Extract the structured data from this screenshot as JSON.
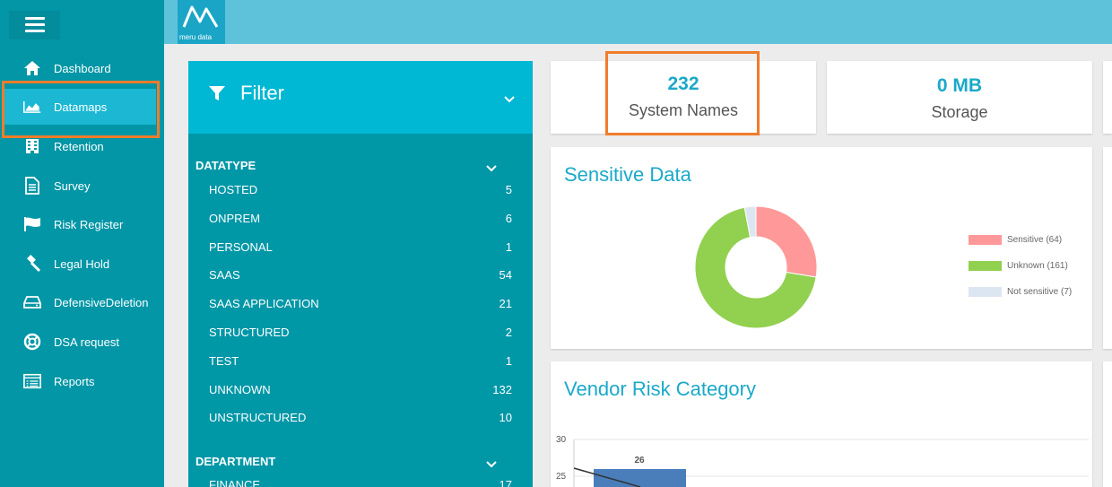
{
  "sidebar": {
    "items": [
      {
        "label": "Dashboard",
        "icon": "home-icon"
      },
      {
        "label": "Datamaps",
        "icon": "area-chart-icon",
        "active": true
      },
      {
        "label": "Retention",
        "icon": "building-icon"
      },
      {
        "label": "Survey",
        "icon": "document-icon"
      },
      {
        "label": "Risk Register",
        "icon": "flag-icon"
      },
      {
        "label": "Legal Hold",
        "icon": "gavel-icon"
      },
      {
        "label": "DefensiveDeletion",
        "icon": "hard-drive-icon"
      },
      {
        "label": "DSA request",
        "icon": "lifebuoy-icon"
      },
      {
        "label": "Reports",
        "icon": "list-icon"
      }
    ]
  },
  "header": {
    "logo_text": "meru data"
  },
  "filter": {
    "title": "Filter",
    "sections": [
      {
        "title": "DATATYPE",
        "items": [
          {
            "label": "HOSTED",
            "count": "5"
          },
          {
            "label": "ONPREM",
            "count": "6"
          },
          {
            "label": "PERSONAL",
            "count": "1"
          },
          {
            "label": "SAAS",
            "count": "54"
          },
          {
            "label": "SAAS APPLICATION",
            "count": "21"
          },
          {
            "label": "STRUCTURED",
            "count": "2"
          },
          {
            "label": "TEST",
            "count": "1"
          },
          {
            "label": "UNKNOWN",
            "count": "132"
          },
          {
            "label": "UNSTRUCTURED",
            "count": "10"
          }
        ]
      },
      {
        "title": "DEPARTMENT",
        "items": [
          {
            "label": "FINANCE",
            "count": "17"
          }
        ]
      }
    ]
  },
  "stats": {
    "system_names": {
      "value": "232",
      "label": "System Names"
    },
    "storage": {
      "value": "0 MB",
      "label": "Storage"
    }
  },
  "sensitive": {
    "title": "Sensitive Data",
    "legend": [
      {
        "label": "Sensitive (64)",
        "value": 64,
        "color": "#ff9999"
      },
      {
        "label": "Unknown (161)",
        "value": 161,
        "color": "#92d050"
      },
      {
        "label": "Not sensitive (7)",
        "value": 7,
        "color": "#dce6f2"
      }
    ]
  },
  "vendor": {
    "title": "Vendor Risk Category",
    "y_ticks": [
      "30",
      "25"
    ],
    "bar_label": "26"
  },
  "colors": {
    "sidebar": "#0296a6",
    "accent": "#1aa9c9",
    "highlight": "#f07d2a"
  }
}
